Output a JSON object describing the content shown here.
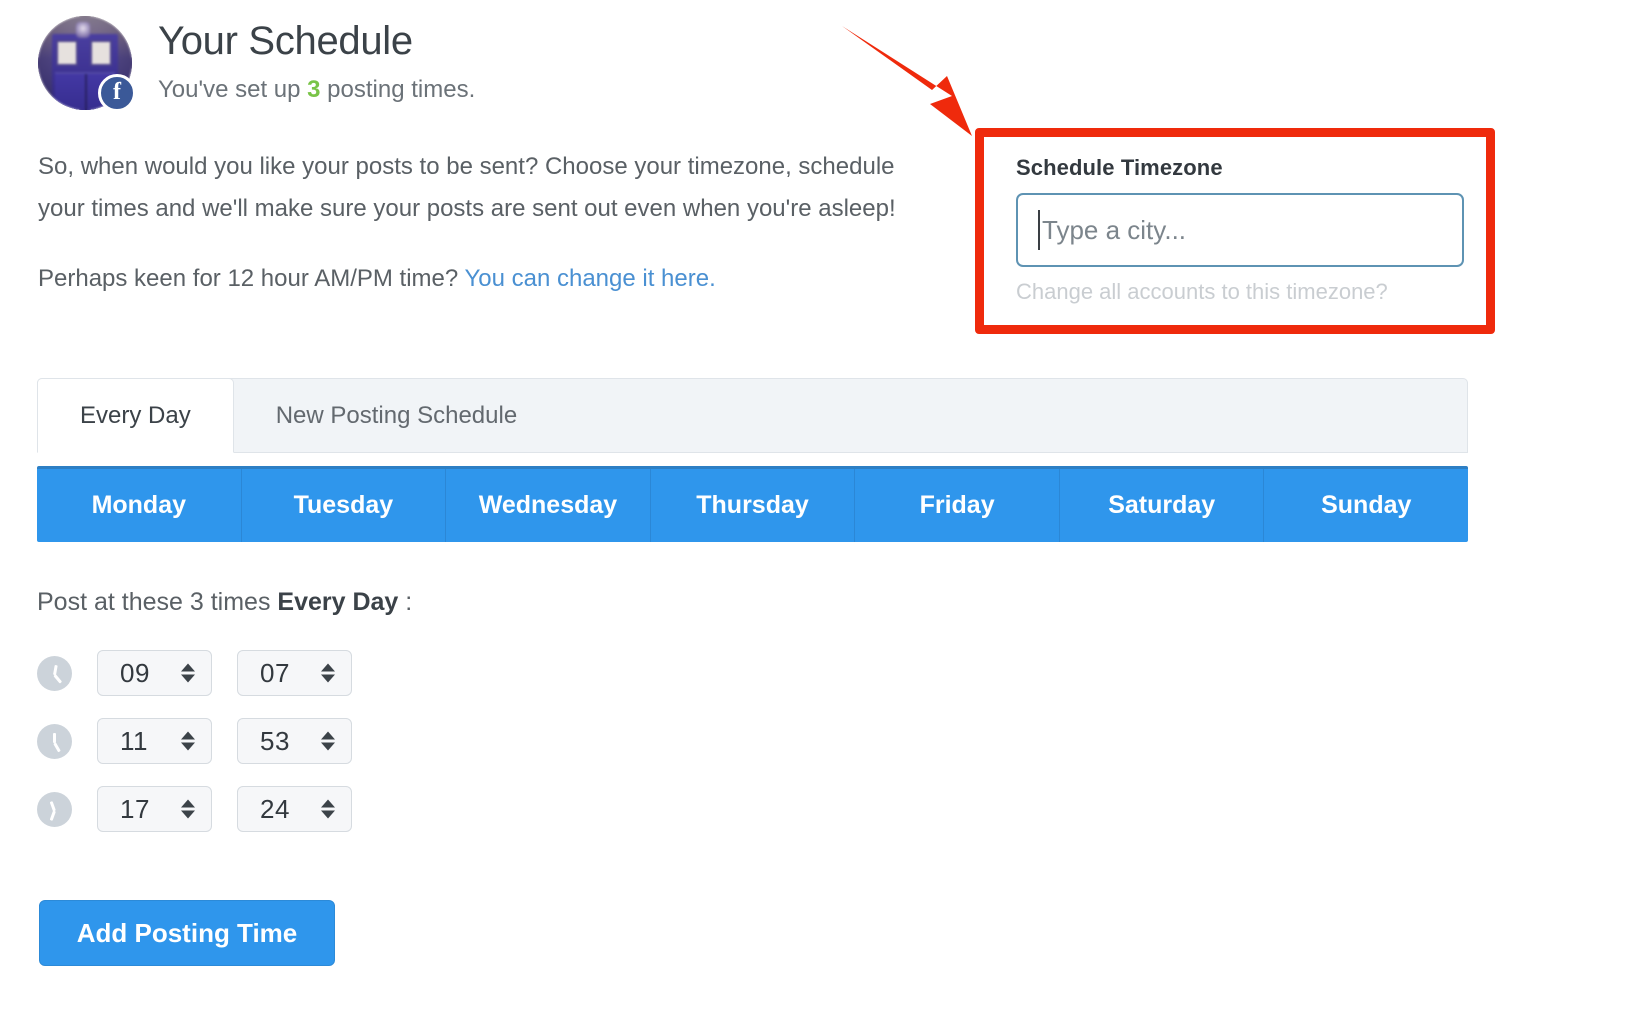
{
  "header": {
    "title": "Your Schedule",
    "subtitle_before": "You've set up ",
    "subtitle_count": "3",
    "subtitle_after": " posting times.",
    "avatar_alt": "tardis-profile-photo",
    "network_badge": "f"
  },
  "intro": {
    "paragraph1": "So, when would you like your posts to be sent? Choose your timezone, schedule your times and we'll make sure your posts are sent out even when you're asleep!",
    "paragraph2_text": "Perhaps keen for 12 hour AM/PM time? ",
    "paragraph2_link": "You can change it here."
  },
  "timezone": {
    "label": "Schedule Timezone",
    "input_value": "",
    "placeholder": "Type a city...",
    "help": "Change all accounts to this timezone?",
    "highlight_color": "#ef2a0c",
    "input_border_color": "#5e93b3"
  },
  "tabs": [
    {
      "label": "Every Day",
      "active": true
    },
    {
      "label": "New Posting Schedule",
      "active": false
    }
  ],
  "days": [
    "Monday",
    "Tuesday",
    "Wednesday",
    "Thursday",
    "Friday",
    "Saturday",
    "Sunday"
  ],
  "times_section": {
    "label_prefix": "Post at these 3 times ",
    "label_bold": "Every Day",
    "label_suffix": " :",
    "rows": [
      {
        "hour": "09",
        "minute": "07"
      },
      {
        "hour": "11",
        "minute": "53"
      },
      {
        "hour": "17",
        "minute": "24"
      }
    ]
  },
  "add_button": {
    "label": "Add Posting Time"
  },
  "colors": {
    "accent_blue": "#2f96ec",
    "link_blue": "#4a90d2",
    "green_count": "#79c447",
    "annotation_red": "#ef2a0c"
  }
}
